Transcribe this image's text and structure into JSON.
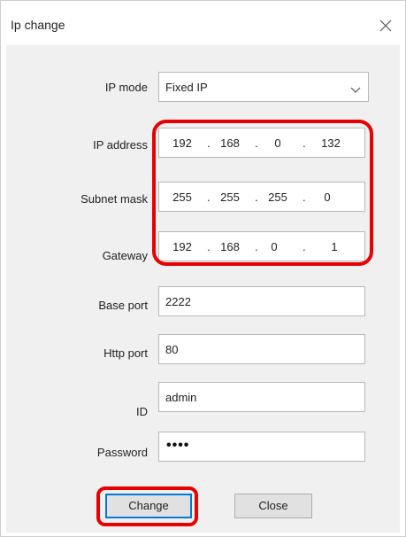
{
  "window": {
    "title": "Ip change",
    "close_icon": "close-icon"
  },
  "form": {
    "ip_mode": {
      "label": "IP mode",
      "value": "Fixed IP"
    },
    "ip_address": {
      "label": "IP address",
      "octets": [
        "192",
        "168",
        "0",
        "132"
      ]
    },
    "subnet_mask": {
      "label": "Subnet mask",
      "octets": [
        "255",
        "255",
        "255",
        "0"
      ]
    },
    "gateway": {
      "label": "Gateway",
      "octets": [
        "192",
        "168",
        "0",
        "1"
      ]
    },
    "base_port": {
      "label": "Base port",
      "value": "2222"
    },
    "http_port": {
      "label": "Http port",
      "value": "80"
    },
    "id": {
      "label": "ID",
      "value": "admin"
    },
    "password": {
      "label": "Password",
      "masked_value": "••••"
    }
  },
  "buttons": {
    "change_label": "Change",
    "close_label": "Close"
  },
  "colors": {
    "annotation": "#e60000",
    "focus_border": "#0078d7"
  }
}
